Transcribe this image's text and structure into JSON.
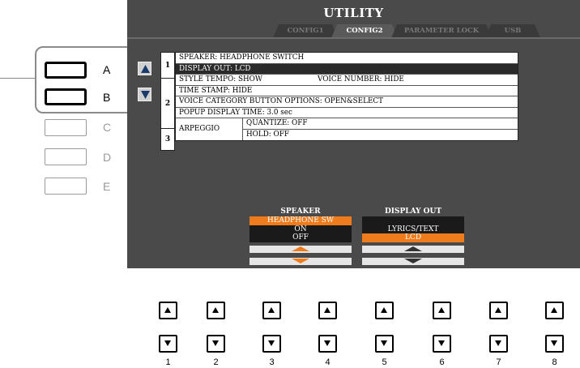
{
  "screen": {
    "title": "UTILITY",
    "tabs": [
      {
        "label": "CONFIG1",
        "active": false
      },
      {
        "label": "CONFIG2",
        "active": true
      },
      {
        "label": "PARAMETER LOCK",
        "active": false
      },
      {
        "label": "USB",
        "active": false
      }
    ],
    "page_numbers": [
      "1",
      "2",
      "3"
    ],
    "rows": {
      "speaker": "SPEAKER: HEADPHONE SWITCH",
      "display_out": "DISPLAY OUT: LCD",
      "style_tempo": "STYLE TEMPO: SHOW",
      "voice_number": "VOICE NUMBER: HIDE",
      "time_stamp": "TIME STAMP: HIDE",
      "voice_category": "VOICE CATEGORY BUTTON OPTIONS: OPEN&SELECT",
      "popup_time": "POPUP DISPLAY TIME: 3.0 sec",
      "arpeggio": "ARPEGGIO",
      "quantize": "QUANTIZE: OFF",
      "hold": "HOLD: OFF"
    },
    "speaker_selector": {
      "header": "SPEAKER",
      "options": [
        "HEADPHONE SW",
        "ON",
        "OFF"
      ],
      "selected": "HEADPHONE SW"
    },
    "display_out_selector": {
      "header": "DISPLAY OUT",
      "options": [
        "",
        "LYRICS/TEXT",
        "LCD"
      ],
      "selected": "LCD"
    },
    "accent_color": "#ef7c1c"
  },
  "side_buttons": [
    {
      "label": "A",
      "active": true
    },
    {
      "label": "B",
      "active": true
    },
    {
      "label": "C",
      "active": false
    },
    {
      "label": "D",
      "active": false
    },
    {
      "label": "E",
      "active": false
    }
  ],
  "bottom_buttons": [
    "1",
    "2",
    "3",
    "4",
    "5",
    "6",
    "7",
    "8"
  ]
}
